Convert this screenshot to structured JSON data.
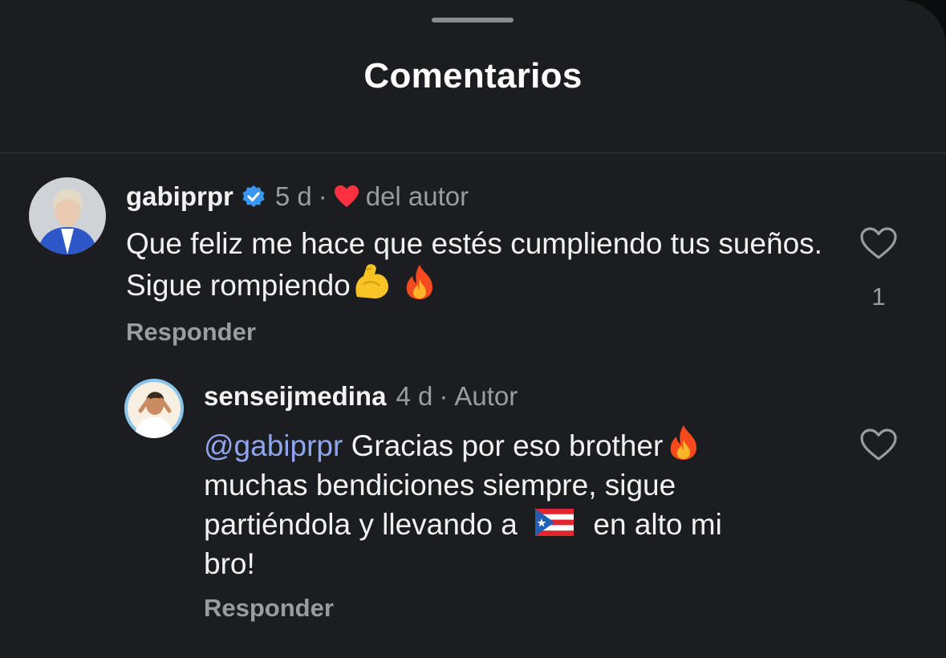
{
  "header": {
    "title": "Comentarios"
  },
  "comments": [
    {
      "username": "gabiprpr",
      "verified": true,
      "time": "5 d",
      "separator": "·",
      "author_like_label": "del autor",
      "text": "Que feliz me hace que estés cumpliendo tus sueños. Sigue rompiendo",
      "emojis": [
        "muscle-emoji",
        "fire-emoji"
      ],
      "like_count": "1",
      "reply_label": "Responder"
    },
    {
      "username": "senseijmedina",
      "time": "4 d",
      "separator": "·",
      "badge": "Autor",
      "mention": "@gabiprpr",
      "text_line1": "Gracias por eso brother",
      "text_line2": "muchas bendiciones siempre, sigue",
      "text_line3_start": "partiéndola y llevando a",
      "text_line3_end": "en alto mi",
      "text_line4": "bro!",
      "emojis": [
        "fire-emoji",
        "puerto-rico-flag-emoji"
      ],
      "reply_label": "Responder"
    }
  ],
  "colors": {
    "background": "#1b1d21",
    "text": "#f2f2f2",
    "muted": "#9a9ca1",
    "mention": "#8fa6ef",
    "verified": "#3897f0",
    "heart": "#ff3040"
  }
}
